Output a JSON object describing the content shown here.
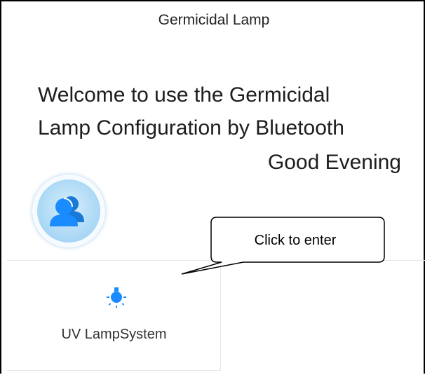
{
  "header": {
    "title": "Germicidal Lamp"
  },
  "welcome": {
    "line1": "Welcome to use the Germicidal",
    "line2": "Lamp Configuration by Bluetooth",
    "greeting": "Good Evening"
  },
  "avatar": {
    "icon": "users-icon"
  },
  "tiles": [
    {
      "label": "UV LampSystem",
      "icon": "lamp-icon"
    }
  ],
  "annotation": {
    "text": "Click to enter"
  },
  "colors": {
    "accent": "#1a8cff",
    "avatar_bg": "#a7d6f5"
  }
}
